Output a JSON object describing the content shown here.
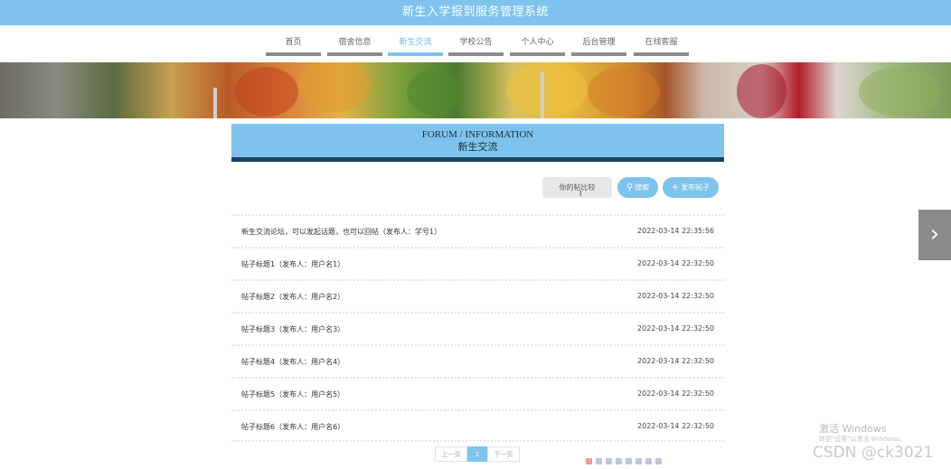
{
  "app": {
    "title": "新生入学报到服务管理系统"
  },
  "nav": {
    "items": [
      {
        "label": "首页",
        "active": false
      },
      {
        "label": "宿舍信息",
        "active": false
      },
      {
        "label": "新生交流",
        "active": true
      },
      {
        "label": "学校公告",
        "active": false
      },
      {
        "label": "个人中心",
        "active": false
      },
      {
        "label": "后台管理",
        "active": false
      },
      {
        "label": "在线客服",
        "active": false
      }
    ]
  },
  "section": {
    "title_en": "FORUM / INFORMATION",
    "title_cn": "新生交流"
  },
  "search": {
    "placeholder": "你的帖比较",
    "search_label": "搜索",
    "publish_label": "发布帖子"
  },
  "posts": [
    {
      "title": "新生交流论坛，可以发起话题，也可以回帖（发布人：学号1）",
      "time": "2022-03-14 22:35:56"
    },
    {
      "title": "帖子标题1（发布人：用户名1）",
      "time": "2022-03-14 22:32:50"
    },
    {
      "title": "帖子标题2（发布人：用户名2）",
      "time": "2022-03-14 22:32:50"
    },
    {
      "title": "帖子标题3（发布人：用户名3）",
      "time": "2022-03-14 22:32:50"
    },
    {
      "title": "帖子标题4（发布人：用户名4）",
      "time": "2022-03-14 22:32:50"
    },
    {
      "title": "帖子标题5（发布人：用户名5）",
      "time": "2022-03-14 22:32:50"
    },
    {
      "title": "帖子标题6（发布人：用户名6）",
      "time": "2022-03-14 22:32:50"
    }
  ],
  "pager": {
    "prev": "上一页",
    "current": "1",
    "next": "下一页"
  },
  "overlay": {
    "win_activate": "激活 Windows",
    "win_activate_hint": "转到\"设置\"以激活 Windows。",
    "csdn": "CSDN @ck3021"
  },
  "colors": {
    "accent": "#7ec3ee",
    "header_border": "#17435e",
    "nav_underline": "#8c8c8c"
  }
}
